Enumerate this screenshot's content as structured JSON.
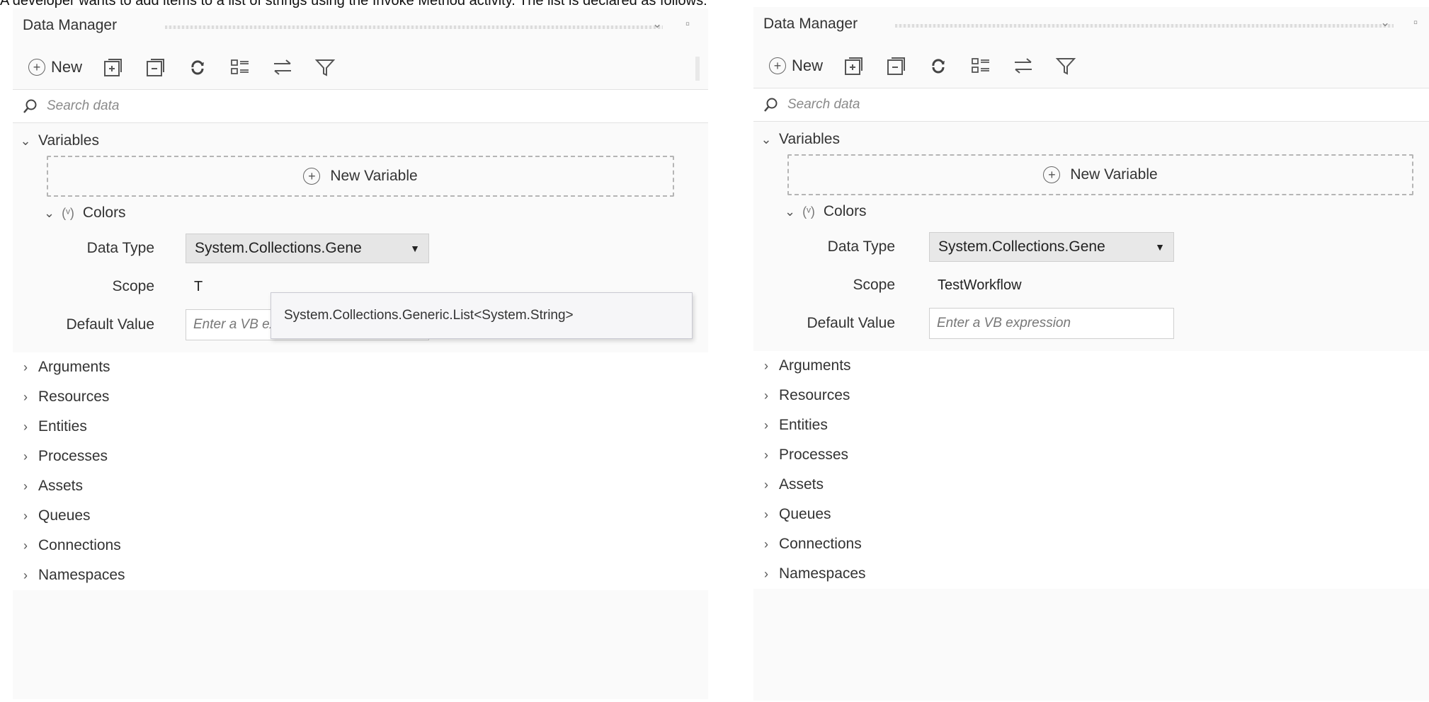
{
  "caption": "A developer wants to add items to a list of strings using the Invoke Method activity. The list is declared as follows:",
  "panels": {
    "left": {
      "title": "Data Manager",
      "pane_controls": "⌄ ▫",
      "toolbar": {
        "new_label": "New"
      },
      "search_placeholder": "Search data",
      "variables_label": "Variables",
      "new_variable_label": "New Variable",
      "variable": {
        "badge": "(ᵛ)",
        "name": "Colors",
        "data_type_label": "Data Type",
        "data_type_value": "System.Collections.Gene",
        "scope_label": "Scope",
        "scope_value": "T",
        "default_value_label": "Default Value",
        "default_value_placeholder": "Enter a VB expression"
      },
      "type_popup": "System.Collections.Generic.List<System.String>",
      "sections": [
        "Arguments",
        "Resources",
        "Entities",
        "Processes",
        "Assets",
        "Queues",
        "Connections",
        "Namespaces"
      ]
    },
    "right": {
      "title": "Data Manager",
      "pane_controls": "⌄ ▫",
      "toolbar": {
        "new_label": "New"
      },
      "search_placeholder": "Search data",
      "variables_label": "Variables",
      "new_variable_label": "New Variable",
      "variable": {
        "badge": "(ᵛ)",
        "name": "Colors",
        "data_type_label": "Data Type",
        "data_type_value": "System.Collections.Gene",
        "scope_label": "Scope",
        "scope_value": "TestWorkflow",
        "default_value_label": "Default Value",
        "default_value_placeholder": "Enter a VB expression"
      },
      "sections": [
        "Arguments",
        "Resources",
        "Entities",
        "Processes",
        "Assets",
        "Queues",
        "Connections",
        "Namespaces"
      ]
    }
  },
  "icons": {
    "new": "plus-circle-icon",
    "expand_all": "expand-all-icon",
    "collapse_all": "collapse-all-icon",
    "refresh": "refresh-icon",
    "group": "group-icon",
    "sort": "sort-icon",
    "filter": "filter-icon",
    "search": "search-icon"
  },
  "colors": {
    "panel_bg": "#fafafa",
    "popup_bg": "#f6f6f8",
    "dropdown_bg": "#e8e8e8"
  }
}
